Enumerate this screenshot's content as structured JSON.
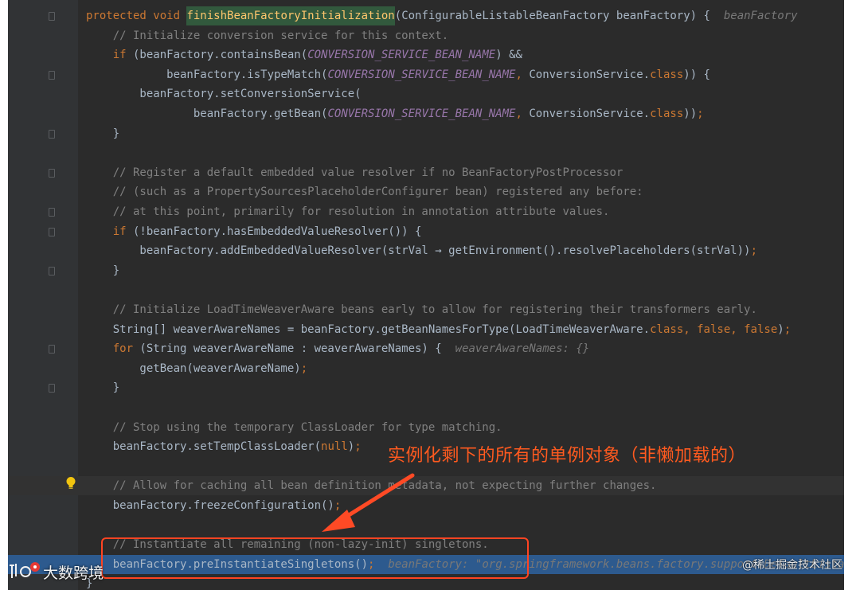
{
  "editor": {
    "lines": [
      {
        "segments": [
          {
            "text": "protected void ",
            "style": "kw"
          },
          {
            "text": "finishBeanFactoryInitialization",
            "style": "fnh"
          },
          {
            "text": "(ConfigurableListableBeanFactory beanFactory) {",
            "style": "plain"
          },
          {
            "text": "  beanFactory",
            "style": "hint"
          }
        ]
      },
      {
        "segments": [
          {
            "text": "    // Initialize conversion service for this context.",
            "style": "cm"
          }
        ]
      },
      {
        "segments": [
          {
            "text": "    ",
            "style": "plain"
          },
          {
            "text": "if",
            "style": "kw"
          },
          {
            "text": " (beanFactory.containsBean(",
            "style": "plain"
          },
          {
            "text": "CONVERSION_SERVICE_BEAN_NAME",
            "style": "cn"
          },
          {
            "text": ") &&",
            "style": "plain"
          }
        ]
      },
      {
        "segments": [
          {
            "text": "            beanFactory.isTypeMatch(",
            "style": "plain"
          },
          {
            "text": "CONVERSION_SERVICE_BEAN_NAME",
            "style": "cn"
          },
          {
            "text": ", ",
            "style": "kw"
          },
          {
            "text": "ConversionService.",
            "style": "plain"
          },
          {
            "text": "class",
            "style": "kw"
          },
          {
            "text": ")) {",
            "style": "plain"
          }
        ]
      },
      {
        "segments": [
          {
            "text": "        beanFactory.setConversionService(",
            "style": "plain"
          }
        ]
      },
      {
        "segments": [
          {
            "text": "                beanFactory.getBean(",
            "style": "plain"
          },
          {
            "text": "CONVERSION_SERVICE_BEAN_NAME",
            "style": "cn"
          },
          {
            "text": ", ",
            "style": "kw"
          },
          {
            "text": "ConversionService.",
            "style": "plain"
          },
          {
            "text": "class",
            "style": "kw"
          },
          {
            "text": "))",
            "style": "plain"
          },
          {
            "text": ";",
            "style": "kw"
          }
        ]
      },
      {
        "segments": [
          {
            "text": "    }",
            "style": "plain"
          }
        ]
      },
      {
        "segments": []
      },
      {
        "segments": [
          {
            "text": "    // Register a default embedded value resolver if no BeanFactoryPostProcessor",
            "style": "cm"
          }
        ]
      },
      {
        "segments": [
          {
            "text": "    // (such as a PropertySourcesPlaceholderConfigurer bean) registered any before:",
            "style": "cm"
          }
        ]
      },
      {
        "segments": [
          {
            "text": "    // at this point, primarily for resolution in annotation attribute values.",
            "style": "cm"
          }
        ]
      },
      {
        "segments": [
          {
            "text": "    ",
            "style": "plain"
          },
          {
            "text": "if",
            "style": "kw"
          },
          {
            "text": " (!beanFactory.hasEmbeddedValueResolver()) {",
            "style": "plain"
          }
        ]
      },
      {
        "segments": [
          {
            "text": "        beanFactory.addEmbeddedValueResolver(strVal → getEnvironment().resolvePlaceholders(strVal))",
            "style": "plain"
          },
          {
            "text": ";",
            "style": "kw"
          }
        ]
      },
      {
        "segments": [
          {
            "text": "    }",
            "style": "plain"
          }
        ]
      },
      {
        "segments": []
      },
      {
        "segments": [
          {
            "text": "    // Initialize LoadTimeWeaverAware beans early to allow for registering their transformers early.",
            "style": "cm"
          }
        ]
      },
      {
        "segments": [
          {
            "text": "    String[] weaverAwareNames = beanFactory.getBeanNamesForType(LoadTimeWeaverAware.",
            "style": "plain"
          },
          {
            "text": "class",
            "style": "kw"
          },
          {
            "text": ", ",
            "style": "kw"
          },
          {
            "text": "false",
            "style": "kw"
          },
          {
            "text": ", ",
            "style": "kw"
          },
          {
            "text": "false",
            "style": "kw"
          },
          {
            "text": ")",
            "style": "plain"
          },
          {
            "text": ";",
            "style": "kw"
          }
        ]
      },
      {
        "segments": [
          {
            "text": "    ",
            "style": "plain"
          },
          {
            "text": "for",
            "style": "kw"
          },
          {
            "text": " (String weaverAwareName : weaverAwareNames) {",
            "style": "plain"
          },
          {
            "text": "  weaverAwareNames: {}",
            "style": "hint"
          }
        ]
      },
      {
        "segments": [
          {
            "text": "        getBean(weaverAwareName)",
            "style": "plain"
          },
          {
            "text": ";",
            "style": "kw"
          }
        ]
      },
      {
        "segments": [
          {
            "text": "    }",
            "style": "plain"
          }
        ]
      },
      {
        "segments": []
      },
      {
        "segments": [
          {
            "text": "    // Stop using the temporary ClassLoader for type matching.",
            "style": "cm"
          }
        ]
      },
      {
        "segments": [
          {
            "text": "    beanFactory.setTempClassLoader(",
            "style": "plain"
          },
          {
            "text": "null",
            "style": "kw"
          },
          {
            "text": ")",
            "style": "plain"
          },
          {
            "text": ";",
            "style": "kw"
          }
        ]
      },
      {
        "segments": []
      },
      {
        "segments": [
          {
            "text": "    // Allow for caching all bean definition metadata, not expecting further changes.",
            "style": "cm"
          }
        ]
      },
      {
        "segments": [
          {
            "text": "    beanFactory.freezeConfiguration()",
            "style": "plain"
          },
          {
            "text": ";",
            "style": "kw"
          }
        ]
      },
      {
        "segments": []
      },
      {
        "segments": [
          {
            "text": "    // Instantiate all remaining (non-lazy-init) singletons.",
            "style": "cm"
          }
        ]
      },
      {
        "segments": [
          {
            "text": "    beanFactory.preInstantiateSingletons()",
            "style": "plain"
          },
          {
            "text": ";",
            "style": "kw"
          },
          {
            "text": "  beanFactory: \"org.springframework.beans.factory.support.DefaultListableBeanFactory",
            "style": "hint"
          }
        ]
      },
      {
        "segments": [
          {
            "text": "}",
            "style": "plain"
          }
        ]
      }
    ]
  },
  "callout": {
    "text": "实例化剩下的所有的单例对象（非懒加载的）",
    "color": "#ff5a1f"
  },
  "watermarks": {
    "left": "大数跨境",
    "right": "@稀土掘金技术社区"
  },
  "colors": {
    "background": "#2b2b2b",
    "gutter": "#313335",
    "keyword": "#cc7832",
    "comment": "#808080",
    "constant": "#9876aa",
    "method": "#ffc66d",
    "text": "#a9b7c6",
    "selection": "#2d5a8e",
    "annotation": "#ff4422"
  },
  "icons": [
    "fold-marker-icon",
    "lightbulb-icon",
    "breakpoint-icon",
    "arrow-icon"
  ]
}
